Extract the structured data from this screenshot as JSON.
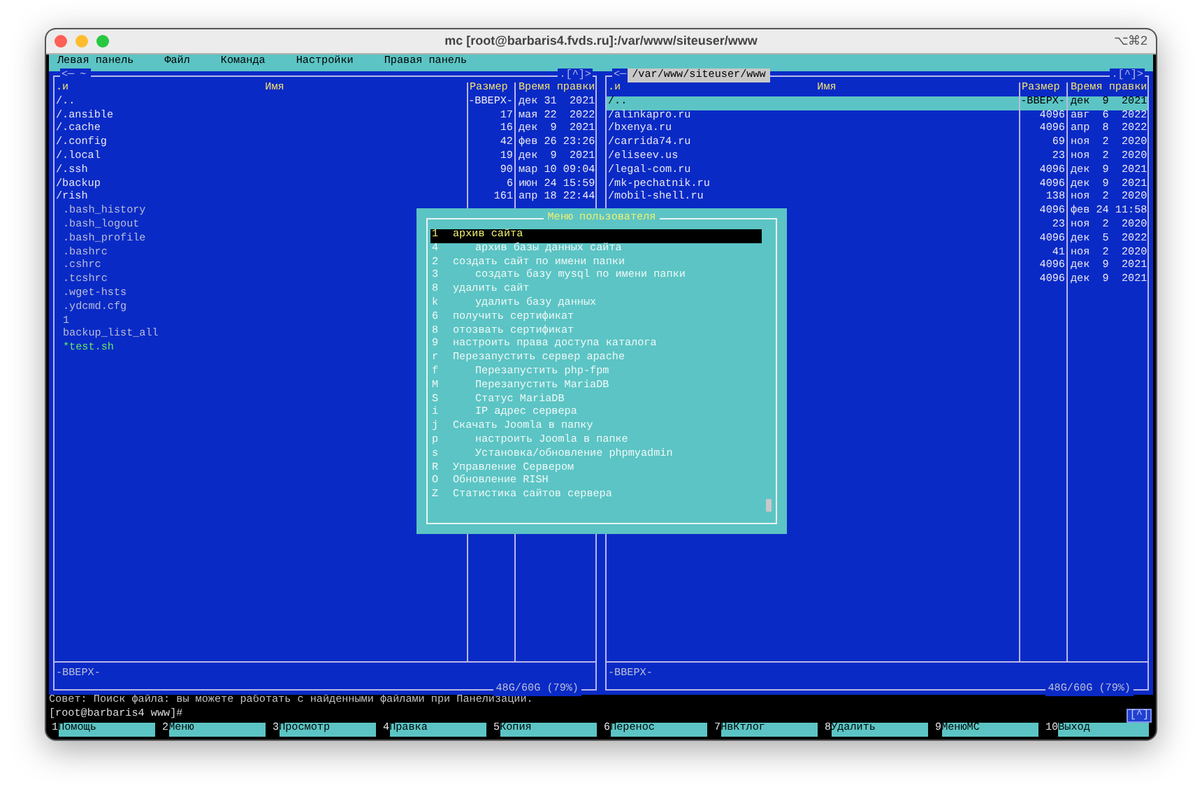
{
  "window": {
    "title": "mc [root@barbaris4.fvds.ru]:/var/www/siteuser/www",
    "shortcut": "⌥⌘2"
  },
  "menu_bar": [
    "Левая панель",
    "Файл",
    "Команда",
    "Настройки",
    "Правая панель"
  ],
  "panels": [
    {
      "active": false,
      "top_left": "<─",
      "path": "~",
      "top_right": ".[^]>",
      "columns": [
        ".и",
        "Имя",
        "Размер",
        "Время правки"
      ],
      "rows": [
        {
          "kind": "dir",
          "name": "/..",
          "size": "-ВВЕРХ-",
          "date": "дек 31  2021",
          "selected": false
        },
        {
          "kind": "dir",
          "name": "/.ansible",
          "size": "17",
          "date": "мая 22  2022",
          "selected": false
        },
        {
          "kind": "dir",
          "name": "/.cache",
          "size": "16",
          "date": "дек  9  2021",
          "selected": false
        },
        {
          "kind": "dir",
          "name": "/.config",
          "size": "42",
          "date": "фев 26 23:26",
          "selected": false
        },
        {
          "kind": "dir",
          "name": "/.local",
          "size": "19",
          "date": "дек  9  2021",
          "selected": false
        },
        {
          "kind": "dir",
          "name": "/.ssh",
          "size": "90",
          "date": "мар 10 09:04",
          "selected": false
        },
        {
          "kind": "dir",
          "name": "/backup",
          "size": "6",
          "date": "июн 24 15:59",
          "selected": false
        },
        {
          "kind": "dir",
          "name": "/rish",
          "size": "161",
          "date": "апр 18 22:44",
          "selected": false
        },
        {
          "kind": "file",
          "name": ".bash_history",
          "selected": false
        },
        {
          "kind": "file",
          "name": ".bash_logout",
          "selected": false
        },
        {
          "kind": "file",
          "name": ".bash_profile",
          "selected": false
        },
        {
          "kind": "file",
          "name": ".bashrc",
          "selected": false
        },
        {
          "kind": "file",
          "name": ".cshrc",
          "selected": false
        },
        {
          "kind": "file",
          "name": ".tcshrc",
          "selected": false
        },
        {
          "kind": "file",
          "name": ".wget-hsts",
          "selected": false
        },
        {
          "kind": "file",
          "name": ".ydcmd.cfg",
          "selected": false
        },
        {
          "kind": "file",
          "name": "1",
          "selected": false
        },
        {
          "kind": "file",
          "name": "backup_list_all",
          "selected": false
        },
        {
          "kind": "exec",
          "name": "*test.sh",
          "selected": false
        }
      ],
      "status": "-ВВЕРХ-",
      "disk": "48G/60G (79%)"
    },
    {
      "active": true,
      "top_left": "<─",
      "path": "/var/www/siteuser/www",
      "top_right": ".[^]>",
      "columns": [
        ".и",
        "Имя",
        "Размер",
        "Время правки"
      ],
      "rows": [
        {
          "kind": "dir",
          "name": "/..",
          "size": "-ВВЕРХ-",
          "date": "дек  9  2021",
          "selected": true
        },
        {
          "kind": "dir",
          "name": "/alinkapro.ru",
          "size": "4096",
          "date": "авг  6  2022",
          "selected": false
        },
        {
          "kind": "dir",
          "name": "/bxenya.ru",
          "size": "4096",
          "date": "апр  8  2022",
          "selected": false
        },
        {
          "kind": "dir",
          "name": "/carrida74.ru",
          "size": "69",
          "date": "ноя  2  2020",
          "selected": false
        },
        {
          "kind": "dir",
          "name": "/eliseev.us",
          "size": "23",
          "date": "ноя  2  2020",
          "selected": false
        },
        {
          "kind": "dir",
          "name": "/legal-com.ru",
          "size": "4096",
          "date": "дек  9  2021",
          "selected": false
        },
        {
          "kind": "dir",
          "name": "/mk-pechatnik.ru",
          "size": "4096",
          "date": "дек  9  2021",
          "selected": false
        },
        {
          "kind": "dir",
          "name": "/mobil-shell.ru",
          "size": "138",
          "date": "ноя  2  2020",
          "selected": false
        },
        {
          "kind": "dir",
          "size": "4096",
          "date": "фев 24 11:58",
          "selected": false
        },
        {
          "kind": "dir",
          "size": "23",
          "date": "ноя  2  2020",
          "selected": false
        },
        {
          "kind": "dir",
          "size": "4096",
          "date": "дек  5  2022",
          "selected": false
        },
        {
          "kind": "dir",
          "size": "41",
          "date": "ноя  2  2020",
          "selected": false
        },
        {
          "kind": "dir",
          "size": "4096",
          "date": "дек  9  2021",
          "selected": false
        },
        {
          "kind": "dir",
          "size": "4096",
          "date": "дек  9  2021",
          "selected": false
        }
      ],
      "status": "-ВВЕРХ-",
      "disk": "48G/60G (79%)"
    }
  ],
  "user_menu": {
    "title": "Меню пользователя",
    "items": [
      {
        "key": "1",
        "label": "архив сайта",
        "selected": true,
        "children": [
          {
            "key": "4",
            "label": "архив базы данных сайта",
            "selected": false
          }
        ]
      },
      {
        "key": "2",
        "label": "создать сайт по имени папки",
        "selected": false,
        "children": [
          {
            "key": "3",
            "label": "создать базу mysql по имени папки",
            "selected": false
          }
        ]
      },
      {
        "key": "8",
        "label": "удалить сайт",
        "selected": false,
        "children": [
          {
            "key": "k",
            "label": "удалить базу данных",
            "selected": false
          }
        ]
      },
      {
        "key": "6",
        "label": "получить сертификат",
        "selected": false
      },
      {
        "key": "8",
        "label": "отозвать сертификат",
        "selected": false
      },
      {
        "key": "9",
        "label": "настроить права доступа каталога",
        "selected": false
      },
      {
        "key": "r",
        "label": "Перезапустить сервер apache",
        "selected": false,
        "children": [
          {
            "key": "f",
            "label": "Перезапустить php-fpm",
            "selected": false
          },
          {
            "key": "M",
            "label": "Перезапустить MariaDB",
            "selected": false
          },
          {
            "key": "S",
            "label": "Статус MariaDB",
            "selected": false
          },
          {
            "key": "i",
            "label": "IP адрес сервера",
            "selected": false
          }
        ]
      },
      {
        "key": "j",
        "label": "Скачать Joomla в папку",
        "selected": false,
        "children": [
          {
            "key": "p",
            "label": "настроить Joomla в папке",
            "selected": false
          },
          {
            "key": "s",
            "label": "Установка/обновление phpmyadmin",
            "selected": false
          }
        ]
      },
      {
        "key": "R",
        "label": "Управление Сервером",
        "selected": false
      },
      {
        "key": "O",
        "label": "Обновление RISH",
        "selected": false
      },
      {
        "key": "Z",
        "label": "Статистика сайтов сервера",
        "selected": false
      }
    ]
  },
  "hint": "Совет: Поиск файла: вы можете работать с найденными файлами при Панелизации.",
  "prompt": "[root@barbaris4 www]#",
  "scroll_marker": "[^]",
  "function_keys": [
    {
      "number": "1",
      "label": "Помощь"
    },
    {
      "number": "2",
      "label": "Меню"
    },
    {
      "number": "3",
      "label": "Просмотр"
    },
    {
      "number": "4",
      "label": "Правка"
    },
    {
      "number": "5",
      "label": "Копия"
    },
    {
      "number": "6",
      "label": "Перенос"
    },
    {
      "number": "7",
      "label": "НвКтлог"
    },
    {
      "number": "8",
      "label": "Удалить"
    },
    {
      "number": "9",
      "label": "МенюМС"
    },
    {
      "number": "10",
      "label": "Выход"
    }
  ]
}
